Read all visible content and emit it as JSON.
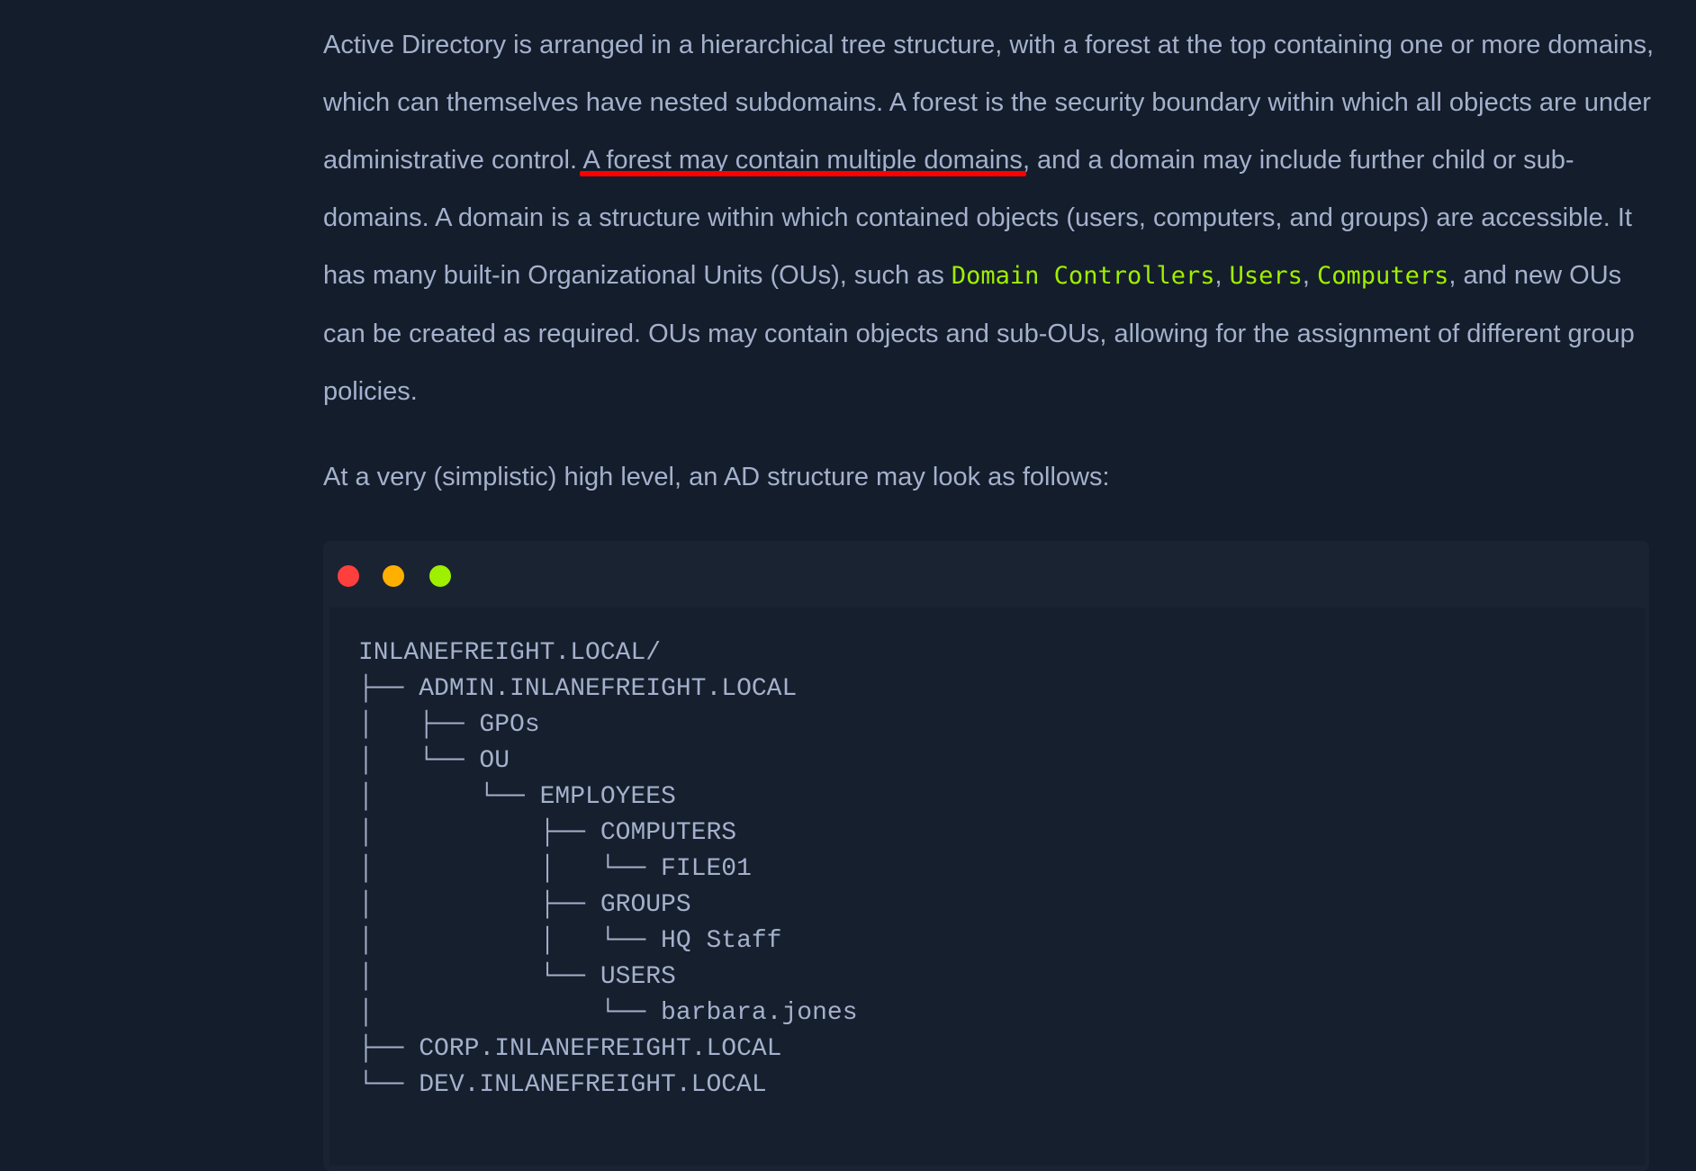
{
  "paragraph1": {
    "t1": "Active Directory is arranged in a hierarchical tree structure, with a forest at the top containing one or more domains, which can themselves have nested subdomains. A forest is the security boundary within which all objects are under administrative control.",
    "highlight": "A forest may contain multiple domains",
    "t2": ", and a domain may include further child or sub-domains. A domain is a structure within which contained objects (users, computers, and groups) are accessible. It has many built-in Organizational Units (OUs), such as ",
    "code1": "Domain Controllers",
    "sep1": ", ",
    "code2": "Users",
    "sep2": ", ",
    "code3": "Computers",
    "t3": ", and new OUs can be created as required. OUs may contain objects and sub-OUs, allowing for the assignment of different group policies."
  },
  "paragraph2": "At a very (simplistic) high level, an AD structure may look as follows:",
  "colors": {
    "close": "#ff3e3e",
    "minimize": "#ffaf00",
    "maximize": "#9fef00",
    "highlight_underline": "#ff0000",
    "inline_code": "#9fef00"
  },
  "code_lines": [
    "INLANEFREIGHT.LOCAL/",
    "├── ADMIN.INLANEFREIGHT.LOCAL",
    "│   ├── GPOs",
    "│   └── OU",
    "│       └── EMPLOYEES",
    "│           ├── COMPUTERS",
    "│           │   └── FILE01",
    "│           ├── GROUPS",
    "│           │   └── HQ Staff",
    "│           └── USERS",
    "│               └── barbara.jones",
    "├── CORP.INLANEFREIGHT.LOCAL",
    "└── DEV.INLANEFREIGHT.LOCAL"
  ]
}
